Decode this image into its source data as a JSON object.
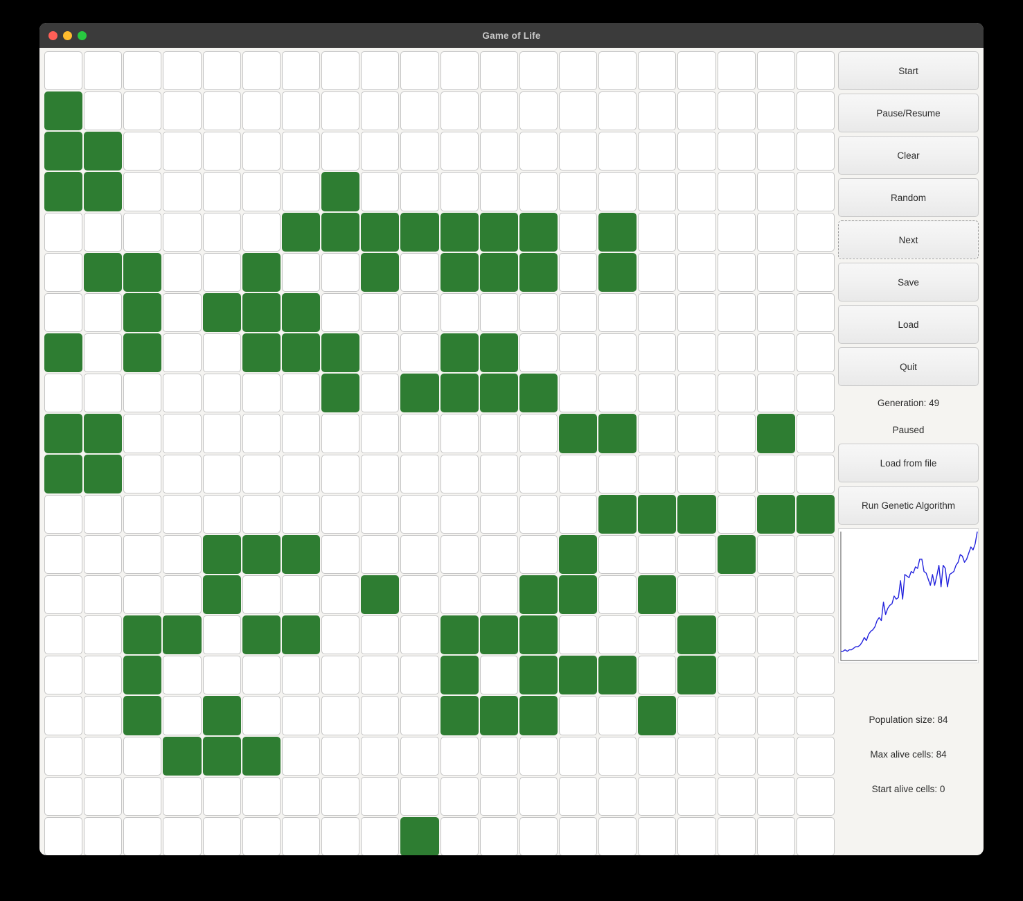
{
  "window": {
    "title": "Game of Life",
    "traffic_lights": [
      "close-button",
      "minimize-button",
      "maximize-button"
    ]
  },
  "colors": {
    "alive_cell": "#2e7d32",
    "dead_cell": "#ffffff",
    "grid_line": "#c4c4c4",
    "chart_line": "#2222dd",
    "titlebar": "#3b3b3b",
    "window_background": "#f5f4f1"
  },
  "sidebar": {
    "buttons": [
      {
        "label": "Start",
        "focused": false
      },
      {
        "label": "Pause/Resume",
        "focused": false
      },
      {
        "label": "Clear",
        "focused": false
      },
      {
        "label": "Random",
        "focused": false
      },
      {
        "label": "Next",
        "focused": true
      },
      {
        "label": "Save",
        "focused": false
      },
      {
        "label": "Load",
        "focused": false
      },
      {
        "label": "Quit",
        "focused": false
      }
    ],
    "generation_label": "Generation: 49",
    "run_state": "Paused",
    "load_from_file_label": "Load from file",
    "run_genetic_algorithm_label": "Run Genetic Algorithm",
    "metrics": [
      "Population size: 84",
      "Max alive cells: 84",
      "Start alive cells: 0"
    ]
  },
  "grid": {
    "rows": 20,
    "cols": 20,
    "alive_cells": [
      [
        1,
        0
      ],
      [
        2,
        0
      ],
      [
        2,
        1
      ],
      [
        3,
        0
      ],
      [
        3,
        1
      ],
      [
        3,
        7
      ],
      [
        4,
        6
      ],
      [
        4,
        7
      ],
      [
        4,
        8
      ],
      [
        4,
        9
      ],
      [
        4,
        10
      ],
      [
        4,
        11
      ],
      [
        4,
        12
      ],
      [
        4,
        14
      ],
      [
        5,
        1
      ],
      [
        5,
        2
      ],
      [
        5,
        5
      ],
      [
        5,
        8
      ],
      [
        5,
        10
      ],
      [
        5,
        11
      ],
      [
        5,
        12
      ],
      [
        5,
        14
      ],
      [
        6,
        2
      ],
      [
        6,
        4
      ],
      [
        6,
        5
      ],
      [
        6,
        6
      ],
      [
        7,
        0
      ],
      [
        7,
        2
      ],
      [
        7,
        5
      ],
      [
        7,
        6
      ],
      [
        7,
        7
      ],
      [
        7,
        10
      ],
      [
        7,
        11
      ],
      [
        8,
        7
      ],
      [
        8,
        9
      ],
      [
        8,
        10
      ],
      [
        8,
        11
      ],
      [
        8,
        12
      ],
      [
        9,
        0
      ],
      [
        9,
        1
      ],
      [
        9,
        13
      ],
      [
        9,
        14
      ],
      [
        9,
        18
      ],
      [
        10,
        0
      ],
      [
        10,
        1
      ],
      [
        11,
        14
      ],
      [
        11,
        15
      ],
      [
        11,
        16
      ],
      [
        11,
        18
      ],
      [
        11,
        19
      ],
      [
        12,
        4
      ],
      [
        12,
        5
      ],
      [
        12,
        6
      ],
      [
        12,
        13
      ],
      [
        12,
        17
      ],
      [
        13,
        4
      ],
      [
        13,
        8
      ],
      [
        13,
        12
      ],
      [
        13,
        13
      ],
      [
        13,
        15
      ],
      [
        14,
        2
      ],
      [
        14,
        3
      ],
      [
        14,
        5
      ],
      [
        14,
        6
      ],
      [
        14,
        10
      ],
      [
        14,
        11
      ],
      [
        14,
        12
      ],
      [
        14,
        16
      ],
      [
        15,
        2
      ],
      [
        15,
        10
      ],
      [
        15,
        12
      ],
      [
        15,
        13
      ],
      [
        15,
        14
      ],
      [
        15,
        16
      ],
      [
        16,
        2
      ],
      [
        16,
        4
      ],
      [
        16,
        10
      ],
      [
        16,
        11
      ],
      [
        16,
        12
      ],
      [
        16,
        15
      ],
      [
        17,
        3
      ],
      [
        17,
        4
      ],
      [
        17,
        5
      ],
      [
        19,
        9
      ]
    ]
  },
  "chart_data": {
    "type": "line",
    "title": "",
    "xlabel": "",
    "ylabel": "",
    "legend": [],
    "grid": false,
    "xlim": [
      0,
      49
    ],
    "ylim": [
      0,
      84
    ],
    "series": [
      {
        "name": "Max alive cells per generation",
        "values": [
          6,
          6,
          7,
          6,
          7,
          7,
          8,
          9,
          9,
          10,
          12,
          15,
          13,
          17,
          19,
          20,
          22,
          26,
          28,
          26,
          38,
          30,
          34,
          36,
          37,
          42,
          40,
          41,
          52,
          40,
          56,
          55,
          54,
          58,
          57,
          61,
          60,
          66,
          66,
          58,
          57,
          53,
          49,
          56,
          49,
          55,
          62,
          48,
          62,
          60,
          48,
          56,
          57,
          58,
          62,
          64,
          69,
          68,
          64,
          66,
          70,
          74,
          72,
          76,
          84
        ]
      }
    ]
  }
}
